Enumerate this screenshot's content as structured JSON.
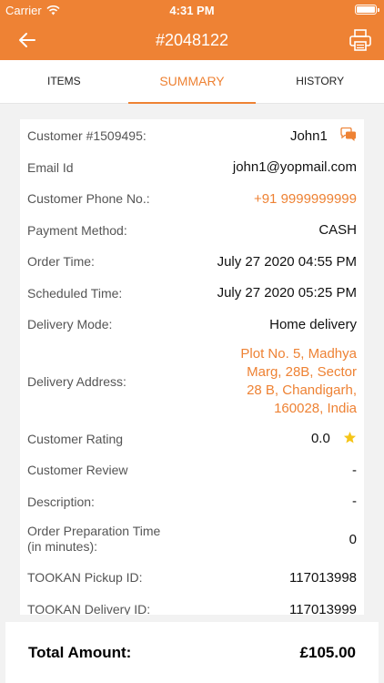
{
  "status_bar": {
    "carrier": "Carrier",
    "time": "4:31 PM"
  },
  "header": {
    "title": "#2048122",
    "back_icon": "arrow-left-icon",
    "print_icon": "printer-icon"
  },
  "tabs": [
    {
      "label": "ITEMS",
      "active": false
    },
    {
      "label": "SUMMARY",
      "active": true
    },
    {
      "label": "HISTORY",
      "active": false
    }
  ],
  "summary": {
    "customer_label": "Customer #1509495:",
    "customer_name": "John1",
    "email_label": "Email Id",
    "email": "john1@yopmail.com",
    "phone_label": "Customer Phone No.:",
    "phone": "+91 9999999999",
    "payment_label": "Payment Method:",
    "payment": "CASH",
    "order_time_label": "Order Time:",
    "order_time": "July 27 2020 04:55 PM",
    "scheduled_label": "Scheduled Time:",
    "scheduled": "July 27 2020 05:25 PM",
    "delivery_mode_label": "Delivery Mode:",
    "delivery_mode": "Home delivery",
    "address_label": "Delivery Address:",
    "address": "Plot No. 5, Madhya Marg, 28B, Sector 28 B, Chandigarh, 160028, India",
    "rating_label": "Customer Rating",
    "rating": "0.0",
    "review_label": "Customer Review",
    "review": "-",
    "description_label": "Description:",
    "description": "-",
    "prep_label_line1": "Order Preparation Time",
    "prep_label_line2": "(in minutes):",
    "prep": "0",
    "pickup_label": "TOOKAN Pickup ID:",
    "pickup": "117013998",
    "delivery_id_label": "TOOKAN Delivery ID:",
    "delivery_id": "117013999"
  },
  "footer": {
    "total_label": "Total Amount:",
    "total_value": "£105.00"
  },
  "colors": {
    "accent": "#ee8234",
    "star": "#f5c518"
  }
}
